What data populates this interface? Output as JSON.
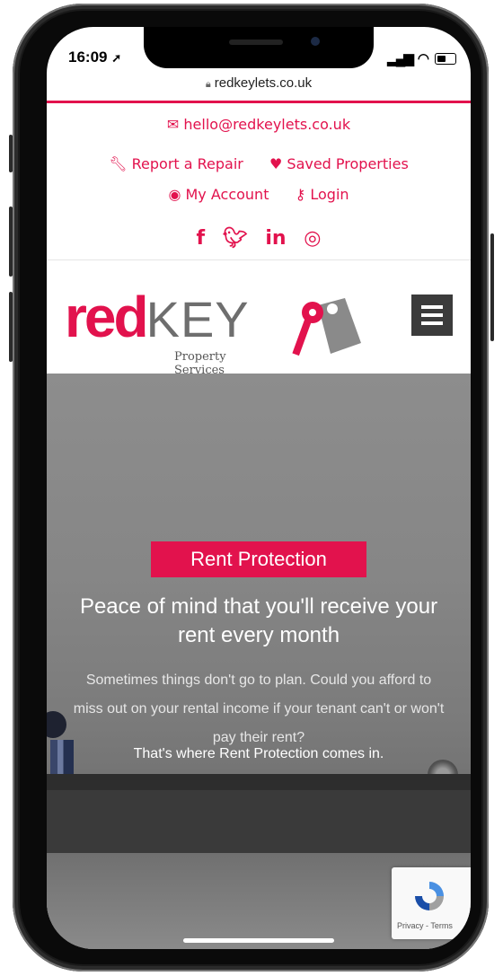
{
  "status": {
    "time": "16:09",
    "nav_arrow": "location-arrow-icon",
    "signal": "signal-icon",
    "wifi": "wifi-icon",
    "battery": "battery-icon"
  },
  "browser": {
    "url": "redkeylets.co.uk"
  },
  "header": {
    "email": "hello@redkeylets.co.uk",
    "links": [
      {
        "label": "Report a Repair",
        "icon": "wrench-icon"
      },
      {
        "label": "Saved Properties",
        "icon": "heart-icon"
      },
      {
        "label": "My Account",
        "icon": "user-circle-icon"
      },
      {
        "label": "Login",
        "icon": "key-icon"
      }
    ],
    "social": [
      "facebook",
      "twitter",
      "linkedin",
      "instagram"
    ]
  },
  "brand": {
    "red": "red",
    "key": "KEY",
    "tagline": "Property Services"
  },
  "hero": {
    "badge": "Rent Protection",
    "heading": "Peace of mind that you'll receive your rent every month",
    "body": "Sometimes things don't go to plan. Could you afford to miss out on your rental income if your tenant can't or won't pay their rent?",
    "callout": "That's where Rent Protection comes in."
  },
  "recaptcha": {
    "text": "Privacy - Terms"
  },
  "colors": {
    "accent": "#e2124d",
    "menu": "#3b3b3b"
  }
}
